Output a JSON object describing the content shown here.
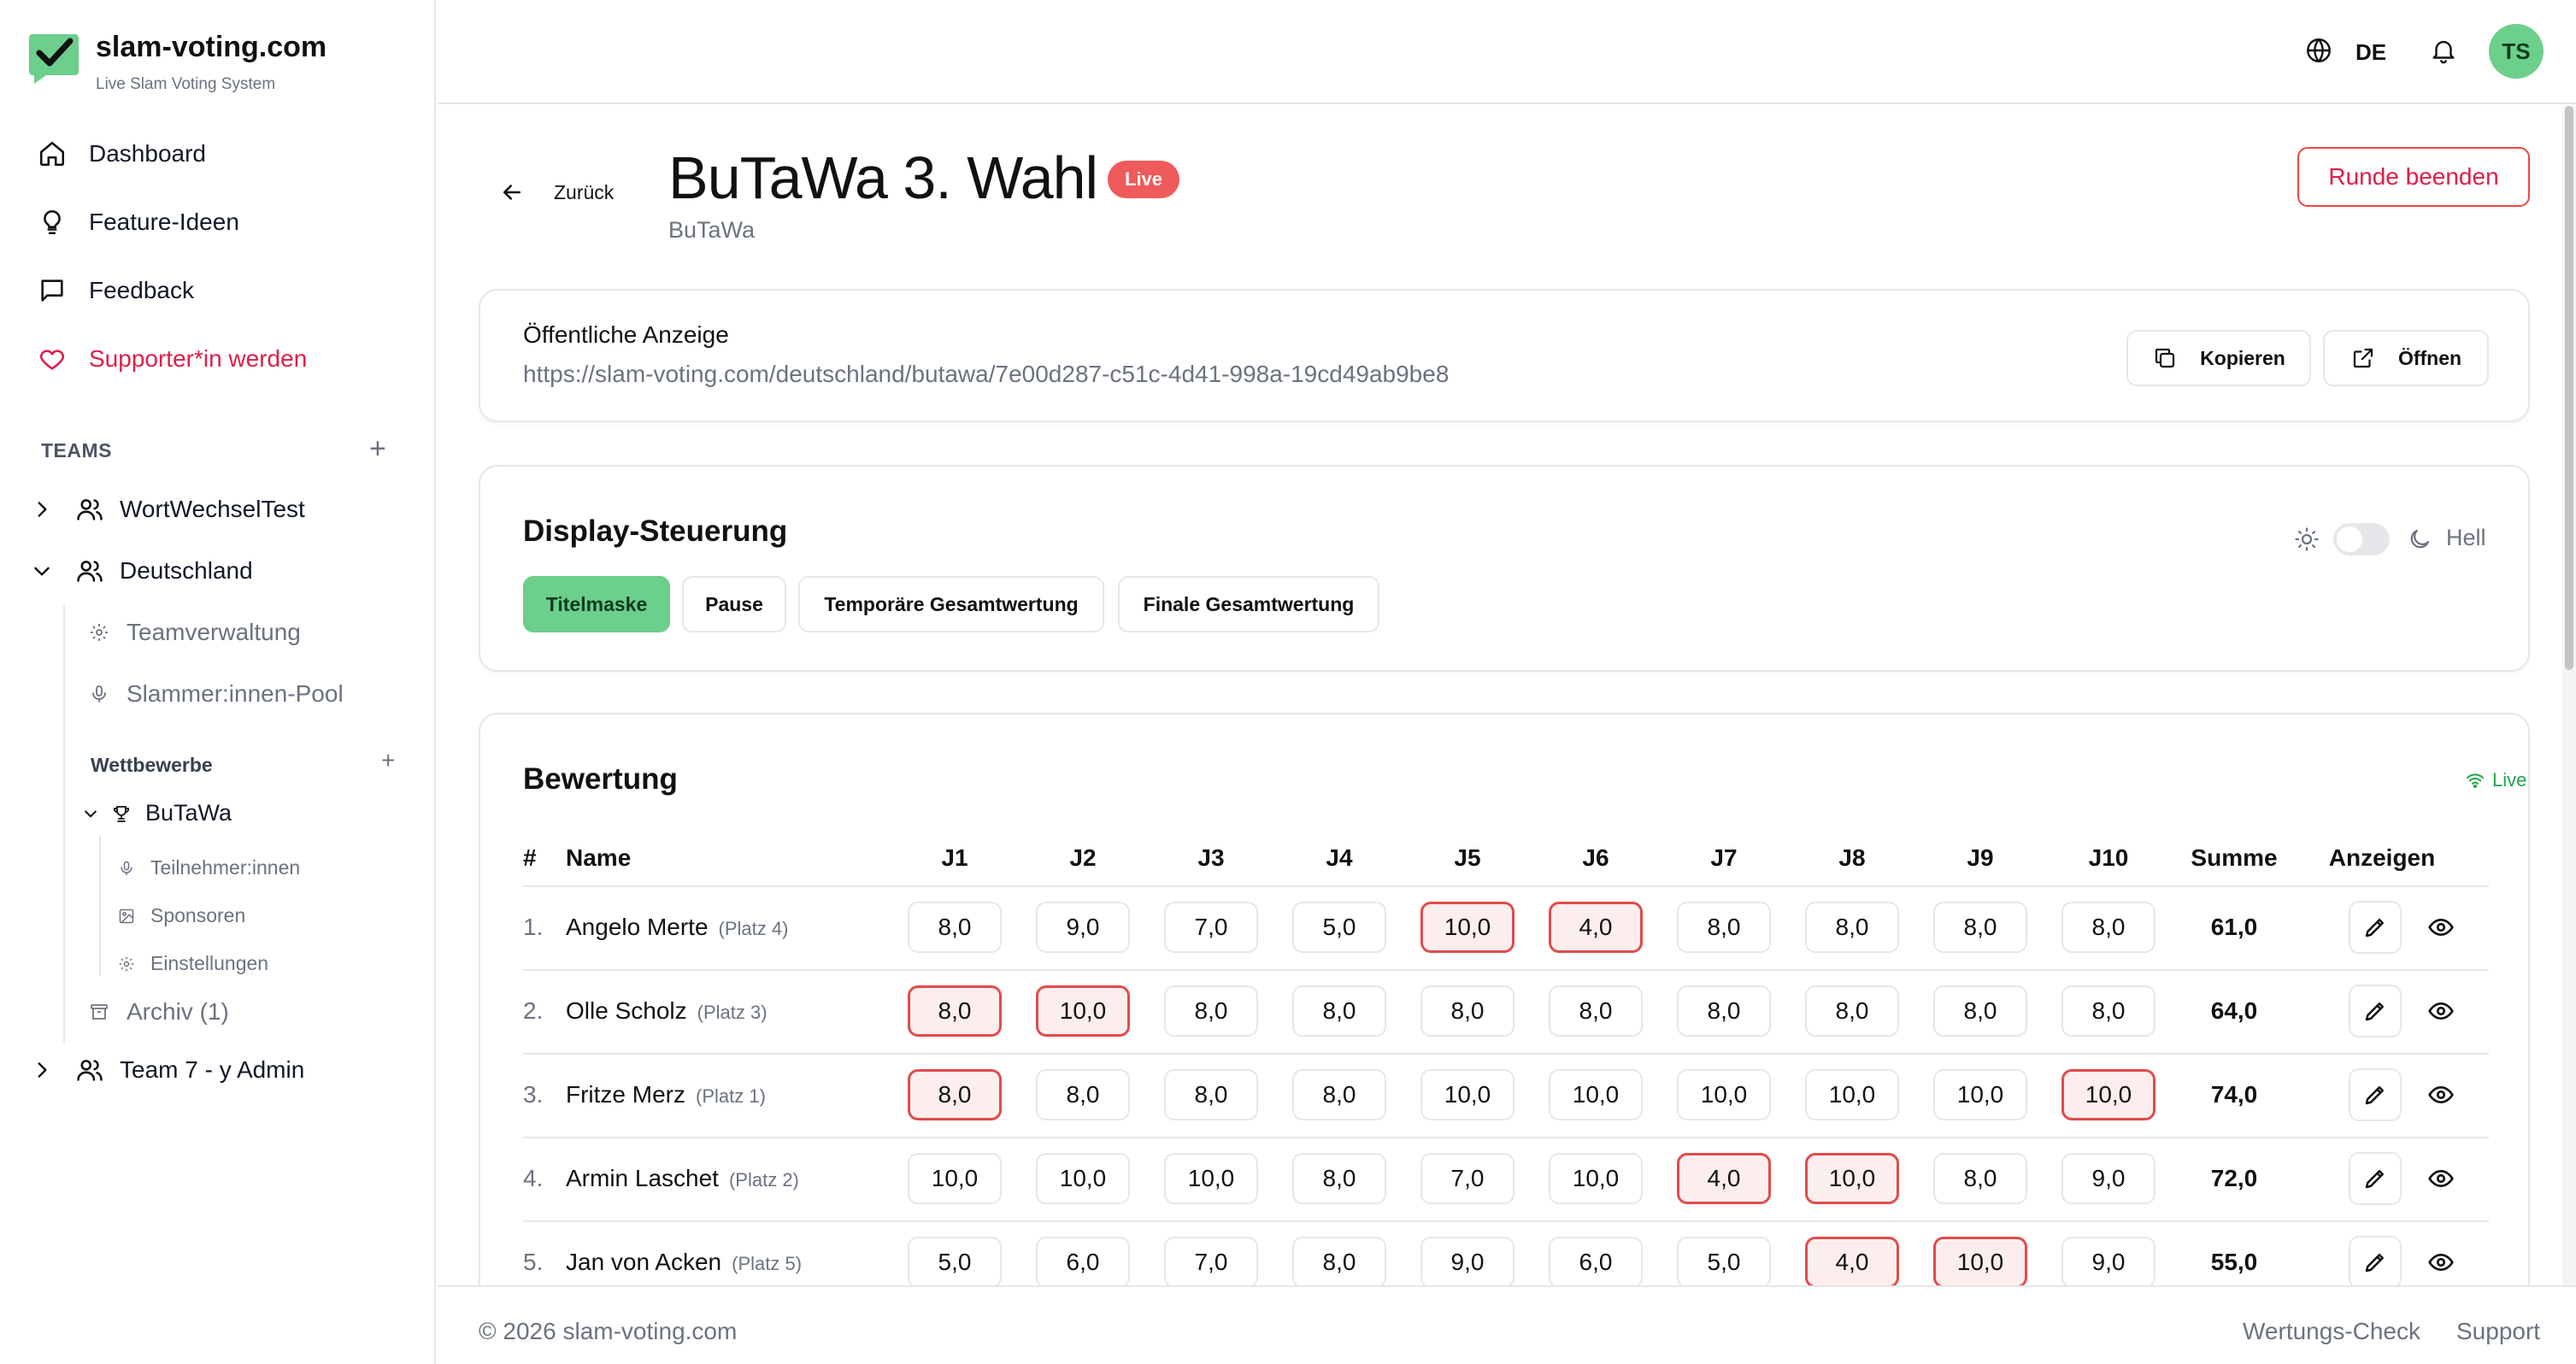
{
  "brand": {
    "title": "slam-voting.com",
    "subtitle": "Live Slam Voting System"
  },
  "nav": [
    {
      "label": "Dashboard",
      "icon": "home-icon"
    },
    {
      "label": "Feature-Ideen",
      "icon": "lightbulb-icon"
    },
    {
      "label": "Feedback",
      "icon": "message-icon"
    },
    {
      "label": "Supporter*in werden",
      "icon": "heart-icon"
    }
  ],
  "teams": {
    "label": "TEAMS",
    "items": [
      {
        "label": "WortWechselTest"
      },
      {
        "label": "Deutschland"
      },
      {
        "label": "Team 7 - y Admin"
      }
    ],
    "deutschland_sub": [
      {
        "label": "Teamverwaltung"
      },
      {
        "label": "Slammer:innen-Pool"
      }
    ],
    "wettbewerbe_label": "Wettbewerbe",
    "competition": "BuTaWa",
    "competition_sub": [
      {
        "label": "Teilnehmer:innen"
      },
      {
        "label": "Sponsoren"
      },
      {
        "label": "Einstellungen"
      }
    ],
    "archive": "Archiv (1)"
  },
  "topbar": {
    "language": "DE",
    "avatar": "TS"
  },
  "header": {
    "back": "Zurück",
    "title": "BuTaWa 3. Wahl",
    "badge": "Live",
    "subtitle": "BuTaWa",
    "end_button": "Runde beenden"
  },
  "public_display": {
    "label": "Öffentliche Anzeige",
    "url": "https://slam-voting.com/deutschland/butawa/7e00d287-c51c-4d41-998a-19cd49ab9be8",
    "copy": "Kopieren",
    "open": "Öffnen"
  },
  "display_control": {
    "title": "Display-Steuerung",
    "buttons": [
      "Titelmaske",
      "Pause",
      "Temporäre Gesamtwertung",
      "Finale Gesamtwertung"
    ],
    "active": "Titelmaske",
    "theme_label": "Hell"
  },
  "rating": {
    "title": "Bewertung",
    "live": "Live",
    "columns": {
      "num": "#",
      "name": "Name",
      "judges": [
        "J1",
        "J2",
        "J3",
        "J4",
        "J5",
        "J6",
        "J7",
        "J8",
        "J9",
        "J10"
      ],
      "sum": "Summe",
      "show": "Anzeigen"
    },
    "rows": [
      {
        "rank": "1.",
        "name": "Angelo Merte",
        "place": "(Platz 4)",
        "scores": [
          "8,0",
          "9,0",
          "7,0",
          "5,0",
          "10,0",
          "4,0",
          "8,0",
          "8,0",
          "8,0",
          "8,0"
        ],
        "highlight": [
          4,
          5
        ],
        "sum": "61,0"
      },
      {
        "rank": "2.",
        "name": "Olle Scholz",
        "place": "(Platz 3)",
        "scores": [
          "8,0",
          "10,0",
          "8,0",
          "8,0",
          "8,0",
          "8,0",
          "8,0",
          "8,0",
          "8,0",
          "8,0"
        ],
        "highlight": [
          0,
          1
        ],
        "sum": "64,0"
      },
      {
        "rank": "3.",
        "name": "Fritze Merz",
        "place": "(Platz 1)",
        "scores": [
          "8,0",
          "8,0",
          "8,0",
          "8,0",
          "10,0",
          "10,0",
          "10,0",
          "10,0",
          "10,0",
          "10,0"
        ],
        "highlight": [
          0,
          9
        ],
        "sum": "74,0"
      },
      {
        "rank": "4.",
        "name": "Armin Laschet",
        "place": "(Platz 2)",
        "scores": [
          "10,0",
          "10,0",
          "10,0",
          "8,0",
          "7,0",
          "10,0",
          "4,0",
          "10,0",
          "8,0",
          "9,0"
        ],
        "highlight": [
          6,
          7
        ],
        "sum": "72,0"
      },
      {
        "rank": "5.",
        "name": "Jan von Acken",
        "place": "(Platz 5)",
        "scores": [
          "5,0",
          "6,0",
          "7,0",
          "8,0",
          "9,0",
          "6,0",
          "5,0",
          "4,0",
          "10,0",
          "9,0"
        ],
        "highlight": [
          7,
          8
        ],
        "sum": "55,0"
      }
    ]
  },
  "footer": {
    "copyright": "© 2026 slam-voting.com",
    "links": [
      "Wertungs-Check",
      "Support"
    ]
  }
}
